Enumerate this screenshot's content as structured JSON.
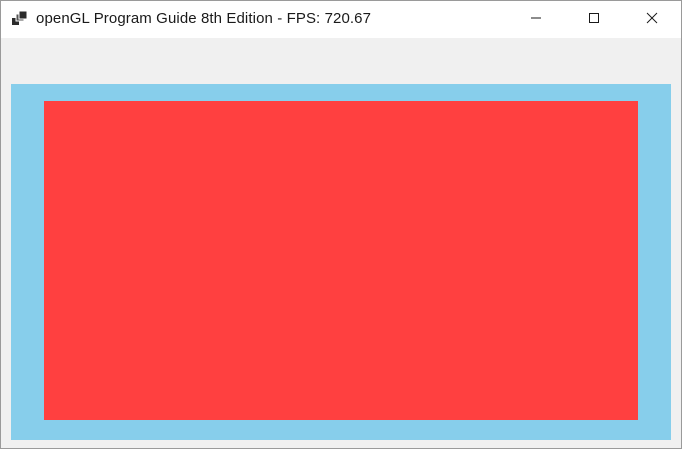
{
  "window": {
    "title": "openGL Program Guide 8th Edition - FPS: 720.67",
    "app_icon": "app-window-icon",
    "controls": {
      "minimize_icon": "minimize-icon",
      "maximize_icon": "maximize-icon",
      "close_icon": "close-icon"
    }
  },
  "canvas": {
    "clear_color": "#87ceeb",
    "quad_color": "#ff4040"
  },
  "colors": {
    "titlebar": "#ffffff",
    "client_background": "#f0f0f0"
  }
}
